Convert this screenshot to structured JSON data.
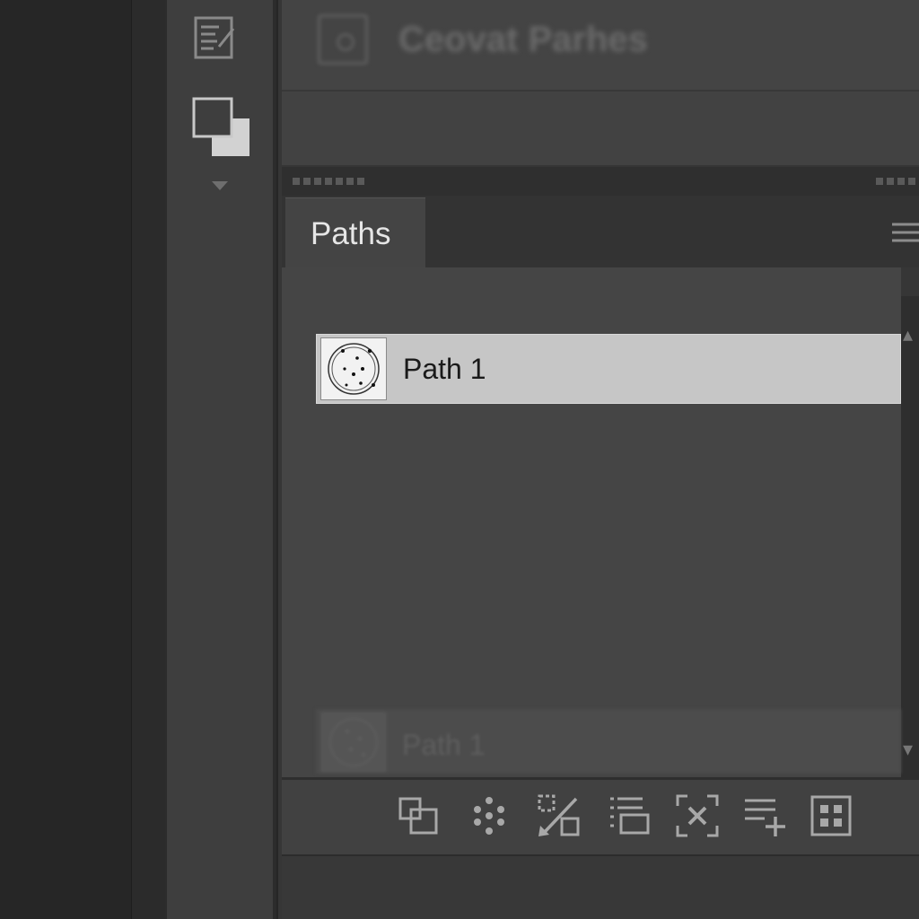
{
  "top_panel": {
    "title": "Ceovat Parhes"
  },
  "paths_panel": {
    "tab_label": "Paths",
    "paths": [
      {
        "name": "Path 1",
        "selected": true
      }
    ],
    "drag_ghost_label": "Path 1"
  },
  "bottom_toolbar": {
    "buttons": [
      {
        "icon": "fill-path-icon"
      },
      {
        "icon": "stroke-path-icon"
      },
      {
        "icon": "load-path-as-selection-icon"
      },
      {
        "icon": "make-work-path-icon"
      },
      {
        "icon": "add-mask-icon"
      },
      {
        "icon": "new-path-icon"
      },
      {
        "icon": "delete-path-icon"
      }
    ]
  },
  "colors": {
    "panel_bg": "#454545",
    "selected_row_bg": "#c6c6c6",
    "tab_text": "#e6e6e6",
    "icon_gray": "#a8a8a8"
  }
}
